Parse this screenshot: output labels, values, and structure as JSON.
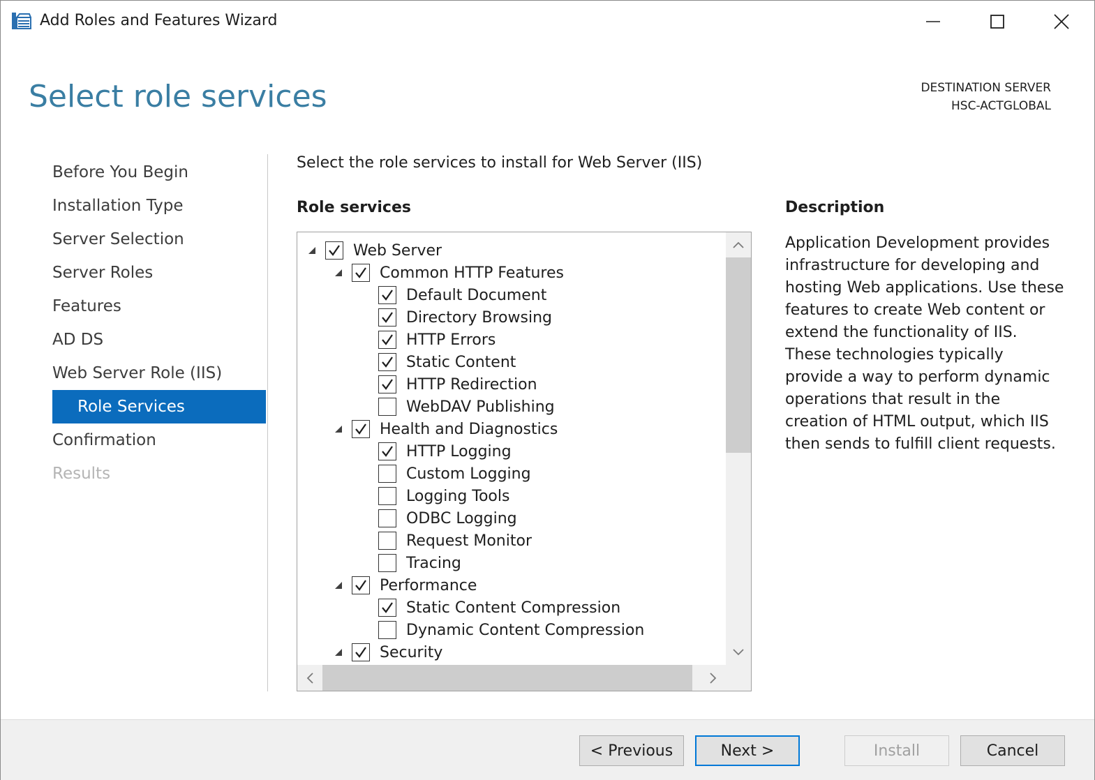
{
  "window": {
    "title": "Add Roles and Features Wizard"
  },
  "header": {
    "page_title": "Select role services",
    "destination_label": "DESTINATION SERVER",
    "destination_server": "HSC-ACTGLOBAL"
  },
  "nav": {
    "items": [
      {
        "label": "Before You Begin",
        "state": "normal"
      },
      {
        "label": "Installation Type",
        "state": "normal"
      },
      {
        "label": "Server Selection",
        "state": "normal"
      },
      {
        "label": "Server Roles",
        "state": "normal"
      },
      {
        "label": "Features",
        "state": "normal"
      },
      {
        "label": "AD DS",
        "state": "normal"
      },
      {
        "label": "Web Server Role (IIS)",
        "state": "normal"
      },
      {
        "label": "Role Services",
        "state": "active"
      },
      {
        "label": "Confirmation",
        "state": "normal"
      },
      {
        "label": "Results",
        "state": "disabled"
      }
    ]
  },
  "main": {
    "instruction": "Select the role services to install for Web Server (IIS)",
    "role_services_label": "Role services",
    "description_label": "Description",
    "description_text": "Application Development provides infrastructure for developing and hosting Web applications. Use these features to create Web content or extend the functionality of IIS. These technologies typically provide a way to perform dynamic operations that result in the creation of HTML output, which IIS then sends to fulfill client requests.",
    "tree": [
      {
        "label": "Web Server",
        "level": 0,
        "expandable": true,
        "checked": true
      },
      {
        "label": "Common HTTP Features",
        "level": 1,
        "expandable": true,
        "checked": true
      },
      {
        "label": "Default Document",
        "level": 2,
        "expandable": false,
        "checked": true
      },
      {
        "label": "Directory Browsing",
        "level": 2,
        "expandable": false,
        "checked": true
      },
      {
        "label": "HTTP Errors",
        "level": 2,
        "expandable": false,
        "checked": true
      },
      {
        "label": "Static Content",
        "level": 2,
        "expandable": false,
        "checked": true
      },
      {
        "label": "HTTP Redirection",
        "level": 2,
        "expandable": false,
        "checked": true
      },
      {
        "label": "WebDAV Publishing",
        "level": 2,
        "expandable": false,
        "checked": false
      },
      {
        "label": "Health and Diagnostics",
        "level": 1,
        "expandable": true,
        "checked": true
      },
      {
        "label": "HTTP Logging",
        "level": 2,
        "expandable": false,
        "checked": true
      },
      {
        "label": "Custom Logging",
        "level": 2,
        "expandable": false,
        "checked": false
      },
      {
        "label": "Logging Tools",
        "level": 2,
        "expandable": false,
        "checked": false
      },
      {
        "label": "ODBC Logging",
        "level": 2,
        "expandable": false,
        "checked": false
      },
      {
        "label": "Request Monitor",
        "level": 2,
        "expandable": false,
        "checked": false
      },
      {
        "label": "Tracing",
        "level": 2,
        "expandable": false,
        "checked": false
      },
      {
        "label": "Performance",
        "level": 1,
        "expandable": true,
        "checked": true
      },
      {
        "label": "Static Content Compression",
        "level": 2,
        "expandable": false,
        "checked": true
      },
      {
        "label": "Dynamic Content Compression",
        "level": 2,
        "expandable": false,
        "checked": false
      },
      {
        "label": "Security",
        "level": 1,
        "expandable": true,
        "checked": true
      }
    ]
  },
  "footer": {
    "previous_label": "< Previous",
    "next_label": "Next >",
    "install_label": "Install",
    "cancel_label": "Cancel"
  },
  "colors": {
    "accent": "#0b6cbd",
    "heading": "#3a7ea3",
    "disabled_text": "#b4b4b4"
  }
}
